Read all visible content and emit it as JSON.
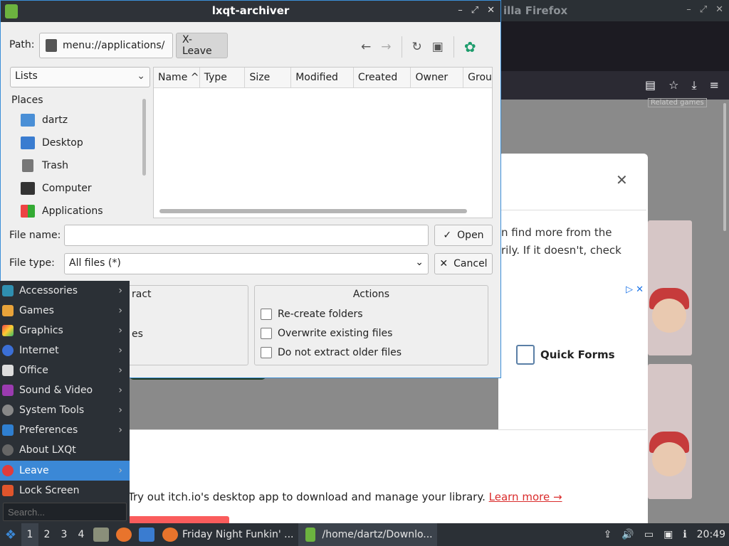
{
  "firefox": {
    "title": "illa Firefox",
    "related": "Related games",
    "card_text1": "n find more from the",
    "card_text2": "rily. If it doesn't, check",
    "quick_forms": "Quick Forms",
    "promo_text": "Try out itch.io's desktop app to download and manage your library.",
    "promo_link": "Learn more →",
    "ad_icons": "▷ ✕"
  },
  "dialog": {
    "title": "lxqt-archiver",
    "path_label": "Path:",
    "crumbs": [
      "menu://applications/",
      "X-Leave"
    ],
    "lists_value": "Lists",
    "places_title": "Places",
    "places": [
      "dartz",
      "Desktop",
      "Trash",
      "Computer",
      "Applications"
    ],
    "columns": [
      "Name",
      "Type",
      "Size",
      "Modified",
      "Created",
      "Owner",
      "Grou"
    ],
    "file_name_label": "File name:",
    "file_name_value": "",
    "file_type_label": "File type:",
    "file_type_value": "All files (*)",
    "open_label": "Open",
    "cancel_label": "Cancel",
    "extract_group_title": "ract",
    "extract_partial": "es",
    "actions_title": "Actions",
    "actions": [
      "Re-create folders",
      "Overwrite existing files",
      "Do not extract older files"
    ]
  },
  "menu": {
    "items": [
      "Accessories",
      "Games",
      "Graphics",
      "Internet",
      "Office",
      "Sound & Video",
      "System Tools",
      "Preferences",
      "About LXQt",
      "Leave",
      "Lock Screen"
    ],
    "search_placeholder": "Search..."
  },
  "panel": {
    "workspaces": [
      "1",
      "2",
      "3",
      "4"
    ],
    "tasks": [
      "Friday Night Funkin' ...",
      "/home/dartz/Downlo..."
    ],
    "clock": "20:49"
  },
  "colors": {
    "accent": "#3b88d6",
    "dark": "#2b3036"
  }
}
